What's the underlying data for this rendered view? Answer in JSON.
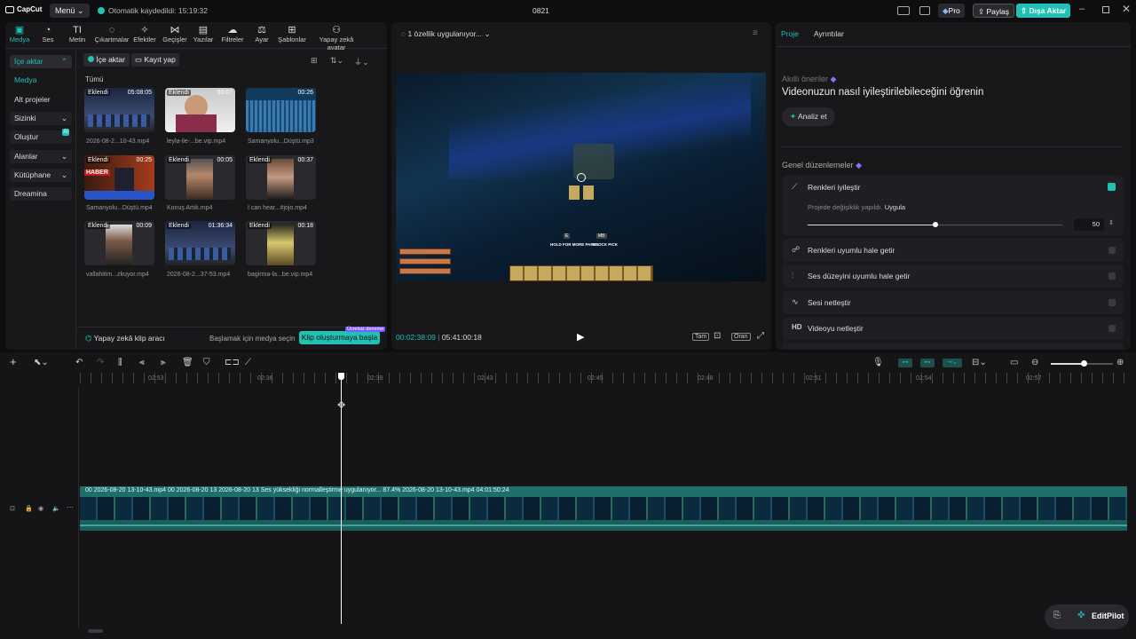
{
  "titlebar": {
    "app_name": "CapCut",
    "menu_label": "Menü",
    "autosave_text": "Otomatik kaydedildi: 15:19:32",
    "project_title": "0821",
    "pro_label": "Pro",
    "share_label": "Paylaş",
    "export_label": "Dışa Aktar"
  },
  "toolbar": {
    "items": [
      {
        "label": "Medya",
        "icon": "media-icon"
      },
      {
        "label": "Ses",
        "icon": "audio-icon"
      },
      {
        "label": "Metin",
        "icon": "text-icon"
      },
      {
        "label": "Çıkartmalar",
        "icon": "sticker-icon"
      },
      {
        "label": "Efektler",
        "icon": "effects-icon"
      },
      {
        "label": "Geçişler",
        "icon": "transitions-icon"
      },
      {
        "label": "Yazılar",
        "icon": "captions-icon"
      },
      {
        "label": "Filtreler",
        "icon": "filters-icon"
      },
      {
        "label": "Ayar",
        "icon": "adjust-icon"
      },
      {
        "label": "Şablonlar",
        "icon": "templates-icon"
      },
      {
        "label": "Yapay zekâ avatar",
        "icon": "ai-avatar-icon"
      }
    ]
  },
  "sidebar": {
    "items": [
      {
        "label": "İçe aktar"
      },
      {
        "label": "Medya"
      },
      {
        "label": "Alt projeler"
      },
      {
        "label": "Sizinki"
      },
      {
        "label": "Oluştur"
      },
      {
        "label": "Alanlar"
      },
      {
        "label": "Kütüphane"
      },
      {
        "label": "Dreamina"
      }
    ]
  },
  "media": {
    "import_button": "İçe aktar",
    "record_button": "Kayıt yap",
    "section_label": "Tümü",
    "clips": [
      {
        "name": "2026-08-2...10-43.mp4",
        "badge": "Eklendi",
        "duration": "05:08:05"
      },
      {
        "name": "leyla-ile-...be.vip.mp4",
        "badge": "Eklendi",
        "duration": "00:07"
      },
      {
        "name": "Samanyolu...Düştü.mp3",
        "badge": "",
        "duration": "00:26"
      },
      {
        "name": "Samanyolu...Düştü.mp4",
        "badge": "Eklendi",
        "duration": "00:25"
      },
      {
        "name": "Konuş Artık.mp4",
        "badge": "Eklendi",
        "duration": "00:05"
      },
      {
        "name": "I can hear...#jojo.mp4",
        "badge": "Eklendi",
        "duration": "00:37"
      },
      {
        "name": "vallahitim...zkuyor.mp4",
        "badge": "Eklendi",
        "duration": "00:09"
      },
      {
        "name": "2026-08-2...37-53.mp4",
        "badge": "Eklendi",
        "duration": "01:36:34"
      },
      {
        "name": "bagirma-la...be.vip.mp4",
        "badge": "Eklendi",
        "duration": "00:18"
      }
    ],
    "haber_text": "HABER",
    "ai_clip_tool": "Yapay zekâ klip aracı",
    "ai_clip_hint": "Başlamak için medya seçin",
    "ai_clip_button": "Klip oluşturmaya başla",
    "ai_clip_badge": "Ücretsiz deneme"
  },
  "player": {
    "status": "1 özellik uygulanıyor...",
    "current_time": "00:02:38:09",
    "total_time": "05:41:00:18",
    "full_label": "Tam",
    "ratio_label": "Oran",
    "hud_hold": "HOLD FOR MORE PARTS",
    "hud_block": "BLOCK PICK",
    "hud_key1": "E",
    "hud_key2": "MB"
  },
  "right_panel": {
    "tab_project": "Proje",
    "tab_details": "Ayrıntılar",
    "smart_suggestions": "Akıllı öneriler",
    "headline": "Videonuzun nasıl iyileştirilebileceğini öğrenin",
    "analyze_button": "Analiz et",
    "general_edits": "Genel düzenlemeler",
    "enhance_colors": "Renkleri iyileştir",
    "change_note": "Projede değişiklik yapıldı.",
    "apply_label": "Uygula",
    "slider_value": 50,
    "slider_fraction": 0.5,
    "rows": [
      {
        "label": "Renkleri uyumlu hale getir",
        "icon": "color-match-icon"
      },
      {
        "label": "Ses düzeyini uyumlu hale getir",
        "icon": "sliders-icon"
      },
      {
        "label": "Sesi netleştir",
        "icon": "audio-wave-icon"
      },
      {
        "label": "Videoyu netleştir",
        "icon": "hd-icon"
      }
    ],
    "hd_text": "HD"
  },
  "timeline": {
    "ruler": [
      "02:53",
      "02:36",
      "02:39",
      "02:43",
      "02:45",
      "02:48",
      "02:51",
      "02:54",
      "02:57"
    ],
    "track_label": "00   2026-08-20 13-10-43.mp4   00   2026-08-20 13   2026-08-20 13   Ses yüksekliği normalleştirme uygulanıyor... 87.4%   2026-08-20 13-10-43.mp4   04:01:50:24",
    "editpilot_label": "EditPilot"
  },
  "colors": {
    "accent": "#21c1b4",
    "panel": "#18181b",
    "background": "#0e0e10",
    "track": "#1f6e69"
  }
}
